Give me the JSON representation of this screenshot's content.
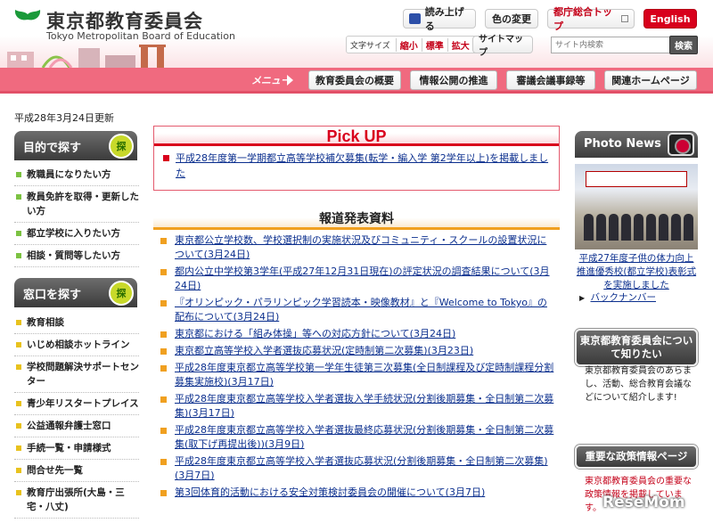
{
  "header": {
    "org_name": "東京都教育委員会",
    "org_name_en": "Tokyo Metropolitan Board of Education",
    "read_aloud": "読み上げる",
    "color_change": "色の変更",
    "tokyo_top": "都庁総合トップ",
    "english": "English",
    "font_size_label": "文字サイズ",
    "font_small": "縮小",
    "font_standard": "標準",
    "font_large": "拡大",
    "sitemap": "サイトマップ",
    "search_placeholder": "サイト内検索",
    "search_button": "検索"
  },
  "menu": {
    "label": "メニュー",
    "items": [
      "教育委員会の概要",
      "情報公開の推進",
      "審議会議事録等",
      "関連ホームページ"
    ]
  },
  "updated": "平成28年3月24日更新",
  "left": {
    "purpose_title": "目的で探す",
    "purpose_badge": "探",
    "purpose_items": [
      "教職員になりたい方",
      "教員免許を取得・更新したい方",
      "都立学校に入りたい方",
      "相談・質問等したい方"
    ],
    "window_title": "窓口を探す",
    "window_badge": "探",
    "window_items": [
      "教育相談",
      "いじめ相談ホットライン",
      "学校問題解決サポートセンター",
      "青少年リスタートプレイス",
      "公益通報弁護士窓口",
      "手続一覧・申請様式",
      "問合せ先一覧",
      "教育庁出張所(大島・三宅・八丈)"
    ]
  },
  "pickup": {
    "title": "Pick UP",
    "item": "平成28年度第一学期都立高等学校補欠募集(転学・編入学 第2学年以上)を掲載しました"
  },
  "press": {
    "title": "報道発表資料",
    "items": [
      "東京都公立学校数、学校選択制の実施状況及びコミュニティ・スクールの設置状況について(3月24日)",
      "都内公立中学校第3学年(平成27年12月31日現在)の評定状況の調査結果について(3月24日)",
      "『オリンピック・パラリンピック学習読本・映像教材』と『Welcome to Tokyo』の配布について(3月24日)",
      "東京都における「組み体操」等への対応方針について(3月24日)",
      "東京都立高等学校入学者選抜応募状況(定時制第二次募集)(3月23日)",
      "平成28年度東京都立高等学校第一学年生徒第三次募集(全日制課程及び定時制課程分割募集実施校)(3月17日)",
      "平成28年度東京都立高等学校入学者選抜入学手続状況(分割後期募集・全日制第二次募集)(3月17日)",
      "平成28年度東京都立高等学校入学者選抜最終応募状況(分割後期募集・全日制第二次募集(取下げ再提出後))(3月9日)",
      "平成28年度東京都立高等学校入学者選抜応募状況(分割後期募集・全日制第二次募集)(3月7日)",
      "第3回体育的活動における安全対策検討委員会の開催について(3月7日)"
    ]
  },
  "right": {
    "photo_title": "Photo News",
    "photo_caption": "平成27年度子供の体力向上推進優秀校(都立学校)表彰式を実施しました",
    "back_number": "バックナンバー",
    "about_title": "東京都教育委員会について知りたい",
    "about_text": "東京都教育委員会のあらまし、活動、総合教育会議などについて紹介します!",
    "policy_title": "重要な政策情報ページ",
    "policy_text": "東京都教育委員会の重要な政策情報を掲載しています。"
  },
  "watermark": "ReseMom"
}
